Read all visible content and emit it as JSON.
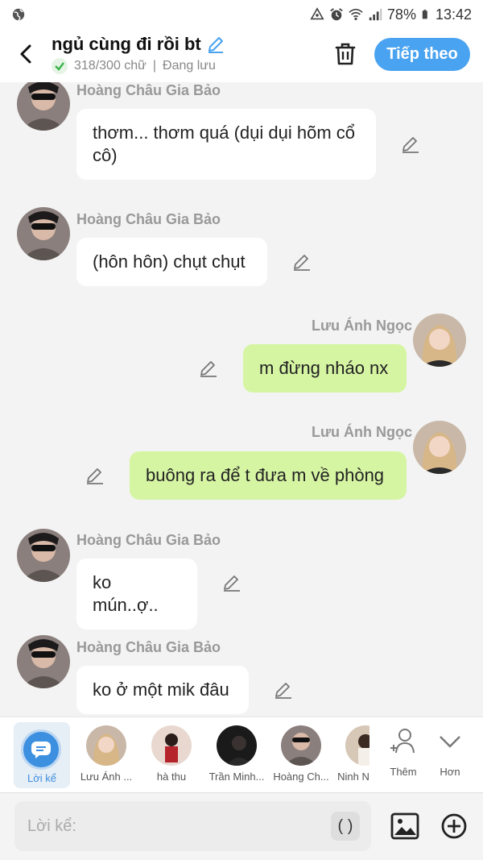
{
  "status_bar": {
    "battery": "78%",
    "time": "13:42"
  },
  "header": {
    "title": "ngủ cùng đi rồi bt",
    "word_count": "318/300 chữ",
    "separator": "|",
    "save_status": "Đang lưu",
    "next_button": "Tiếp theo"
  },
  "messages": [
    {
      "sender": "Hoàng Châu Gia Bảo",
      "text": "thơm... thơm quá (dụi dụi hõm cổ cô)",
      "side": "left"
    },
    {
      "sender": "Hoàng Châu Gia Bảo",
      "text": "(hôn hôn) chụt chụt",
      "side": "left"
    },
    {
      "sender": "Lưu Ánh Ngọc",
      "text": "m đừng nháo nx",
      "side": "right"
    },
    {
      "sender": "Lưu Ánh Ngọc",
      "text": "buông ra để t đưa m về phòng",
      "side": "right"
    },
    {
      "sender": "Hoàng Châu Gia Bảo",
      "text": "ko mún..ợ..",
      "side": "left"
    },
    {
      "sender": "Hoàng Châu Gia Bảo",
      "text": "ko ở một mik đâu",
      "side": "left"
    }
  ],
  "characters": [
    {
      "label": "Lời kể"
    },
    {
      "label": "Lưu Ánh ..."
    },
    {
      "label": "hà thu"
    },
    {
      "label": "Trần Minh..."
    },
    {
      "label": "Hoàng Ch..."
    },
    {
      "label": "Ninh N"
    },
    {
      "label": "Thêm"
    },
    {
      "label": "Hơn"
    }
  ],
  "input": {
    "placeholder": "Lời kể:",
    "paren_label": "( )"
  },
  "colors": {
    "accent": "#4aa3f0",
    "my_bubble": "#d6f5a3",
    "other_bubble": "#ffffff"
  }
}
